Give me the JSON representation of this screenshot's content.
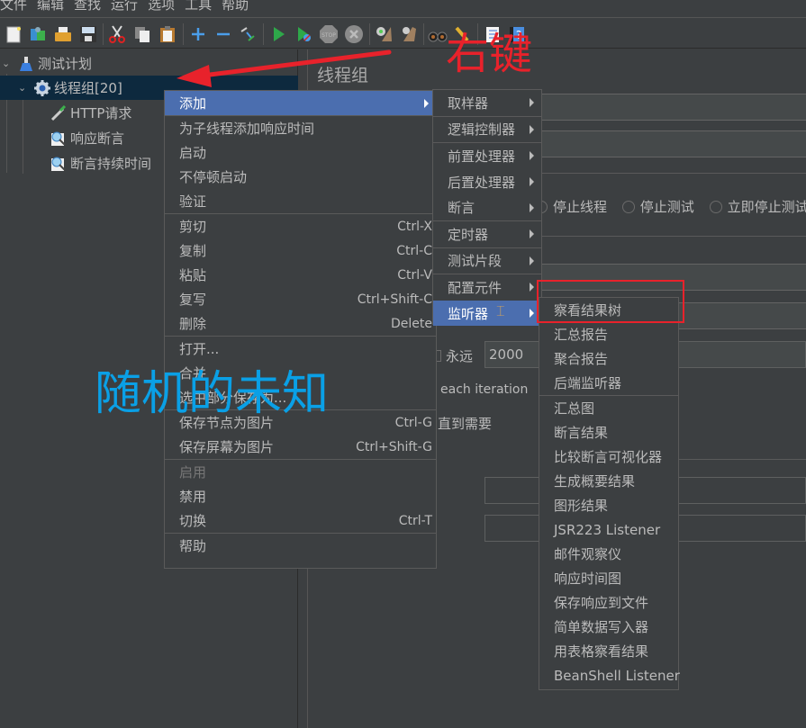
{
  "menubar": {
    "items": [
      "文件",
      "编辑",
      "查找",
      "运行",
      "选项",
      "工具",
      "帮助"
    ]
  },
  "toolbar": {
    "buttons": [
      "new-icon",
      "templates-icon",
      "open-icon",
      "save-icon",
      "cut-icon",
      "copy-icon",
      "paste-icon",
      "expand-icon",
      "collapse-icon",
      "toggle-icon",
      "start-icon",
      "start-no-pauses-icon",
      "stop-icon",
      "shutdown-icon",
      "clear-icon",
      "clear-all-icon",
      "search-icon",
      "reset-search-icon",
      "function-helper-icon",
      "help-icon"
    ]
  },
  "tree": {
    "items": [
      {
        "label": "测试计划",
        "icon": "test-plan-icon",
        "level": 0,
        "expanded": true
      },
      {
        "label": "线程组[20]",
        "icon": "thread-group-icon",
        "level": 1,
        "expanded": true,
        "selected": true
      },
      {
        "label": "HTTP请求",
        "icon": "http-sampler-icon",
        "level": 2
      },
      {
        "label": "响应断言",
        "icon": "assertion-icon",
        "level": 2
      },
      {
        "label": "断言持续时间",
        "icon": "assertion-icon",
        "level": 2
      }
    ]
  },
  "panel": {
    "title": "线程组",
    "radio_options": [
      "停止线程",
      "停止测试",
      "立即停止测试"
    ],
    "forever_label": "永远",
    "loop_value": "2000",
    "each_iteration": "each iteration",
    "delay_label": "直到需要"
  },
  "context_menu": {
    "items": [
      {
        "label": "添加",
        "submenu": true,
        "highlighted": true
      },
      {
        "sep": true
      },
      {
        "label": "为子线程添加响应时间"
      },
      {
        "label": "启动"
      },
      {
        "label": "不停顿启动"
      },
      {
        "label": "验证"
      },
      {
        "sep": true
      },
      {
        "label": "剪切",
        "shortcut": "Ctrl-X"
      },
      {
        "label": "复制",
        "shortcut": "Ctrl-C"
      },
      {
        "label": "粘贴",
        "shortcut": "Ctrl-V"
      },
      {
        "label": "复写",
        "shortcut": "Ctrl+Shift-C"
      },
      {
        "label": "删除",
        "shortcut": "Delete"
      },
      {
        "sep": true
      },
      {
        "label": "打开..."
      },
      {
        "label": "合并"
      },
      {
        "label": "选中部分保存为..."
      },
      {
        "sep": true
      },
      {
        "label": "保存节点为图片",
        "shortcut": "Ctrl-G"
      },
      {
        "label": "保存屏幕为图片",
        "shortcut": "Ctrl+Shift-G"
      },
      {
        "sep": true
      },
      {
        "label": "启用",
        "disabled": true
      },
      {
        "label": "禁用"
      },
      {
        "label": "切换",
        "shortcut": "Ctrl-T"
      },
      {
        "sep": true
      },
      {
        "label": "帮助"
      }
    ]
  },
  "add_submenu": {
    "items": [
      {
        "label": "取样器"
      },
      {
        "sep": true
      },
      {
        "label": "逻辑控制器"
      },
      {
        "sep": true
      },
      {
        "label": "前置处理器"
      },
      {
        "label": "后置处理器"
      },
      {
        "label": "断言"
      },
      {
        "sep": true
      },
      {
        "label": "定时器"
      },
      {
        "sep": true
      },
      {
        "label": "测试片段"
      },
      {
        "sep": true
      },
      {
        "label": "配置元件"
      },
      {
        "label": "监听器",
        "highlighted": true
      }
    ]
  },
  "listener_submenu": {
    "items": [
      {
        "label": "察看结果树"
      },
      {
        "label": "汇总报告"
      },
      {
        "label": "聚合报告"
      },
      {
        "label": "后端监听器"
      },
      {
        "sep": true
      },
      {
        "label": "汇总图"
      },
      {
        "label": "断言结果"
      },
      {
        "label": "比较断言可视化器"
      },
      {
        "label": "生成概要结果"
      },
      {
        "label": "图形结果"
      },
      {
        "label": "JSR223 Listener"
      },
      {
        "label": "邮件观察仪"
      },
      {
        "label": "响应时间图"
      },
      {
        "label": "保存响应到文件"
      },
      {
        "label": "简单数据写入器"
      },
      {
        "label": "用表格察看结果"
      },
      {
        "label": "BeanShell Listener"
      }
    ]
  },
  "annotations": {
    "right_click_label": "右键",
    "watermark": "随机的未知",
    "arrow_color": "#e8222b",
    "watermark_color": "#0aa0e6"
  },
  "colors": {
    "background": "#3c3f41",
    "selection": "#4b6eaf",
    "tree_selection": "#0d293e",
    "text": "#bbbbbb"
  }
}
